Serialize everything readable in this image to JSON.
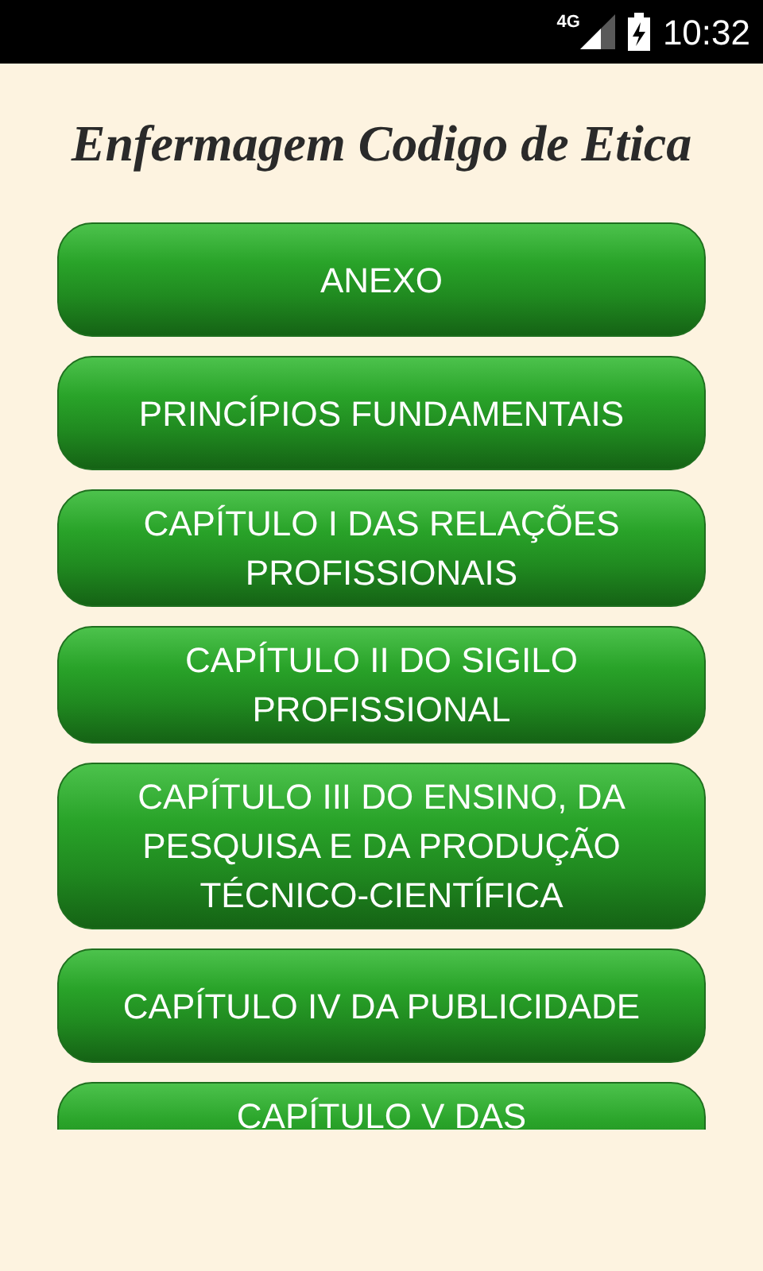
{
  "status_bar": {
    "network": "4G",
    "time": "10:32"
  },
  "title": "Enfermagem Codigo de Etica",
  "buttons": [
    {
      "label": "ANEXO"
    },
    {
      "label": "PRINCÍPIOS FUNDAMENTAIS"
    },
    {
      "label": "CAPÍTULO I DAS RELAÇÕES PROFISSIONAIS"
    },
    {
      "label": "CAPÍTULO II DO SIGILO PROFISSIONAL"
    },
    {
      "label": "CAPÍTULO III DO ENSINO, DA PESQUISA E DA PRODUÇÃO TÉCNICO-CIENTÍFICA"
    },
    {
      "label": "CAPÍTULO IV DA PUBLICIDADE"
    },
    {
      "label": "CAPÍTULO V DAS"
    }
  ]
}
